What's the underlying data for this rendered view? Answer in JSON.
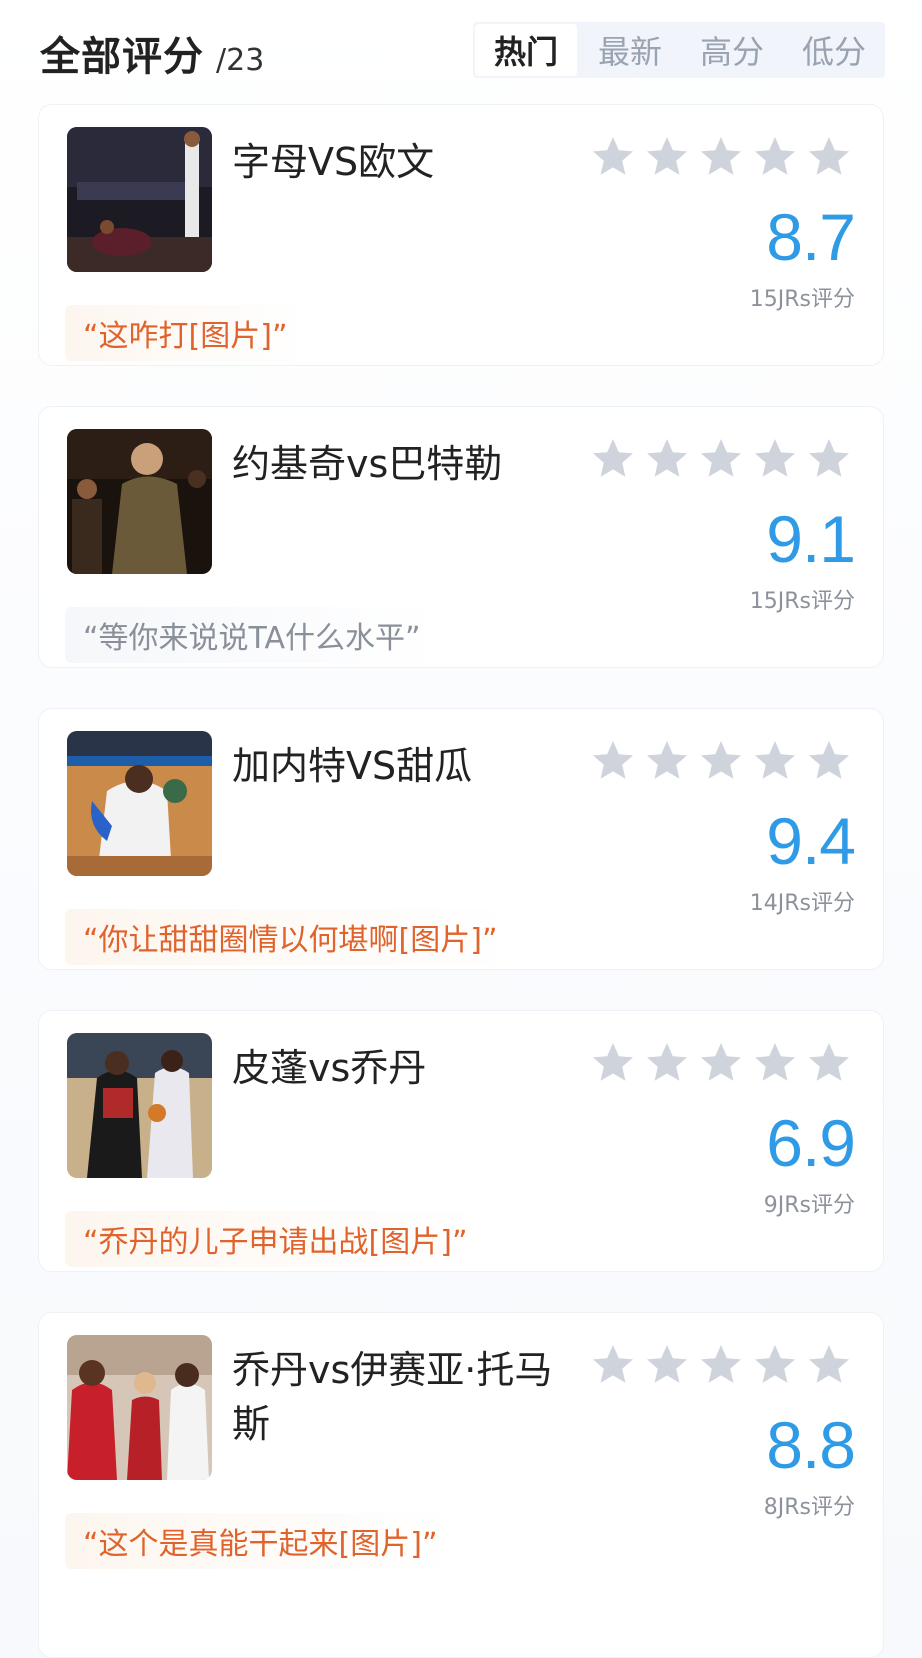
{
  "header": {
    "title": "全部评分",
    "count": "/23",
    "tabs": [
      {
        "label": "热门",
        "active": true
      },
      {
        "label": "最新",
        "active": false
      },
      {
        "label": "高分",
        "active": false
      },
      {
        "label": "低分",
        "active": false
      }
    ]
  },
  "colors": {
    "score": "#2f9be6",
    "quote_highlight": "#e0632c",
    "quote_muted": "#8a9099",
    "star": "#cfd3db"
  },
  "stars_icon": "star-icon",
  "ratings": [
    {
      "name": "字母VS欧文",
      "score": "8.7",
      "votes": "15JRs评分",
      "quote": "“这咋打[图片]”",
      "quote_style": "highlight"
    },
    {
      "name": "约基奇vs巴特勒",
      "score": "9.1",
      "votes": "15JRs评分",
      "quote": "“等你来说说TA什么水平”",
      "quote_style": "muted"
    },
    {
      "name": "加内特VS甜瓜",
      "score": "9.4",
      "votes": "14JRs评分",
      "quote": "“你让甜甜圈情以何堪啊[图片]”",
      "quote_style": "highlight"
    },
    {
      "name": "皮蓬vs乔丹",
      "score": "6.9",
      "votes": "9JRs评分",
      "quote": "“乔丹的儿子申请出战[图片]”",
      "quote_style": "highlight"
    },
    {
      "name": "乔丹vs伊赛亚·托马斯",
      "score": "8.8",
      "votes": "8JRs评分",
      "quote": "“这个是真能干起来[图片]”",
      "quote_style": "highlight"
    }
  ]
}
